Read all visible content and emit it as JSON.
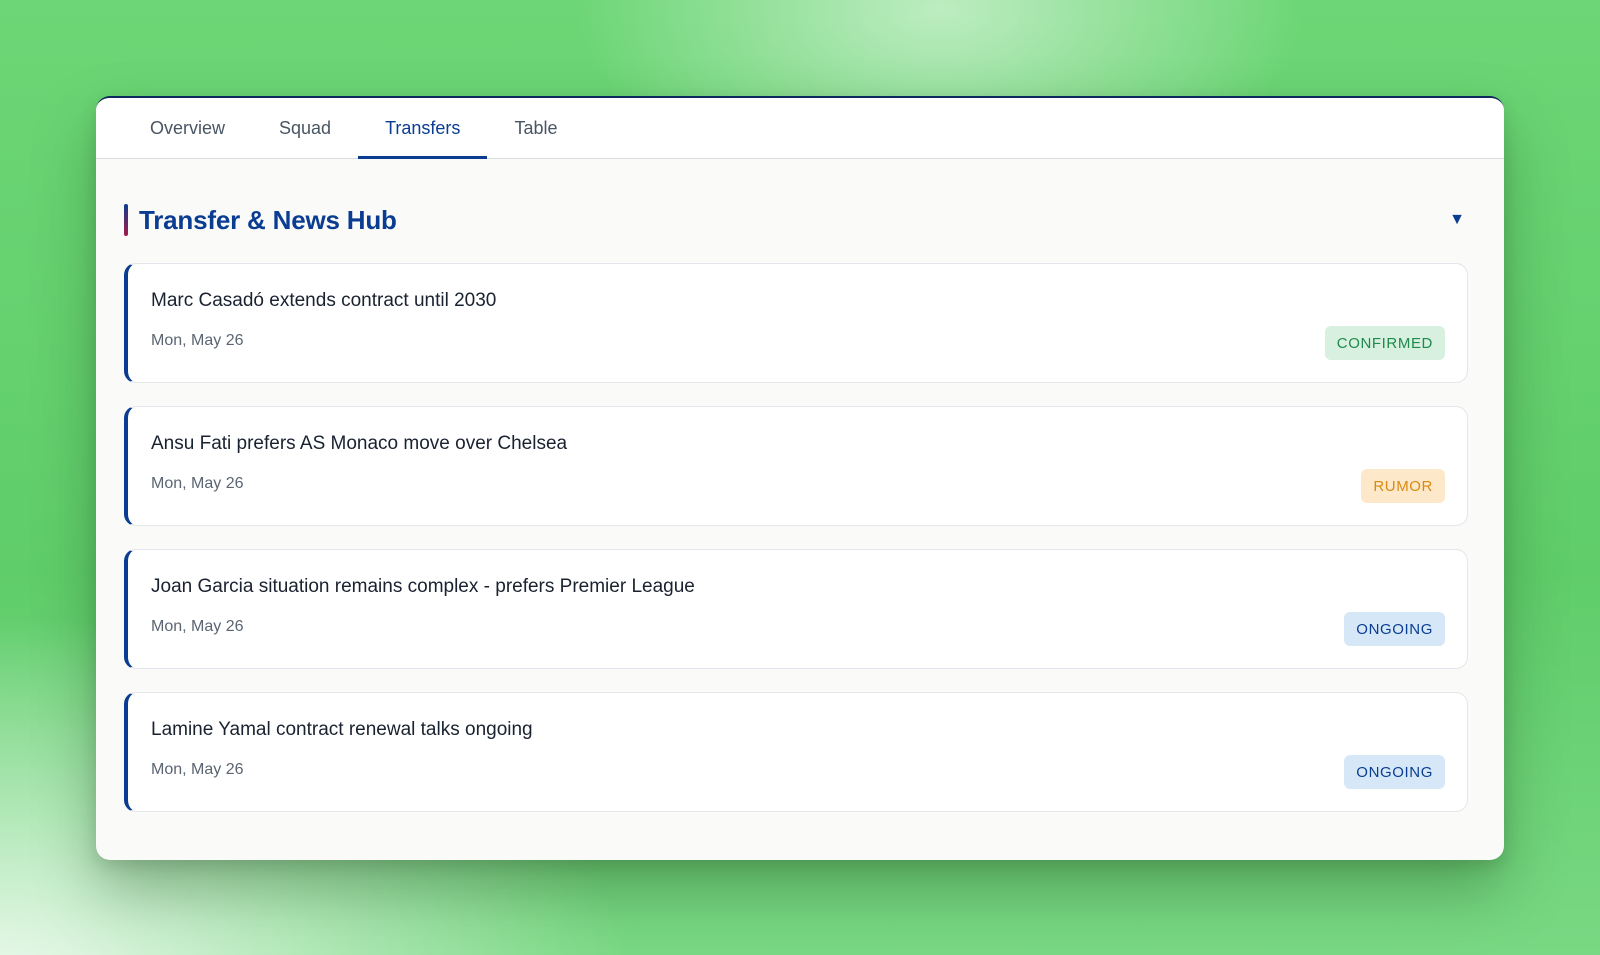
{
  "tabs": [
    {
      "label": "Overview",
      "active": false
    },
    {
      "label": "Squad",
      "active": false
    },
    {
      "label": "Transfers",
      "active": true
    },
    {
      "label": "Table",
      "active": false
    }
  ],
  "section": {
    "title": "Transfer & News Hub",
    "toggle_icon": "▼"
  },
  "news": [
    {
      "headline": "Marc Casadó extends contract until 2030",
      "date": "Mon, May 26",
      "status": "CONFIRMED",
      "status_type": "confirmed"
    },
    {
      "headline": "Ansu Fati prefers AS Monaco move over Chelsea",
      "date": "Mon, May 26",
      "status": "RUMOR",
      "status_type": "rumor"
    },
    {
      "headline": "Joan Garcia situation remains complex - prefers Premier League",
      "date": "Mon, May 26",
      "status": "ONGOING",
      "status_type": "ongoing"
    },
    {
      "headline": "Lamine Yamal contract renewal talks ongoing",
      "date": "Mon, May 26",
      "status": "ONGOING",
      "status_type": "ongoing"
    }
  ],
  "colors": {
    "accent": "#0a3d91",
    "secondary_accent": "#a61a49",
    "confirmed": "#1f8a4c",
    "rumor": "#d98a12",
    "ongoing": "#0a3d91",
    "background": "#5fcd6a"
  }
}
